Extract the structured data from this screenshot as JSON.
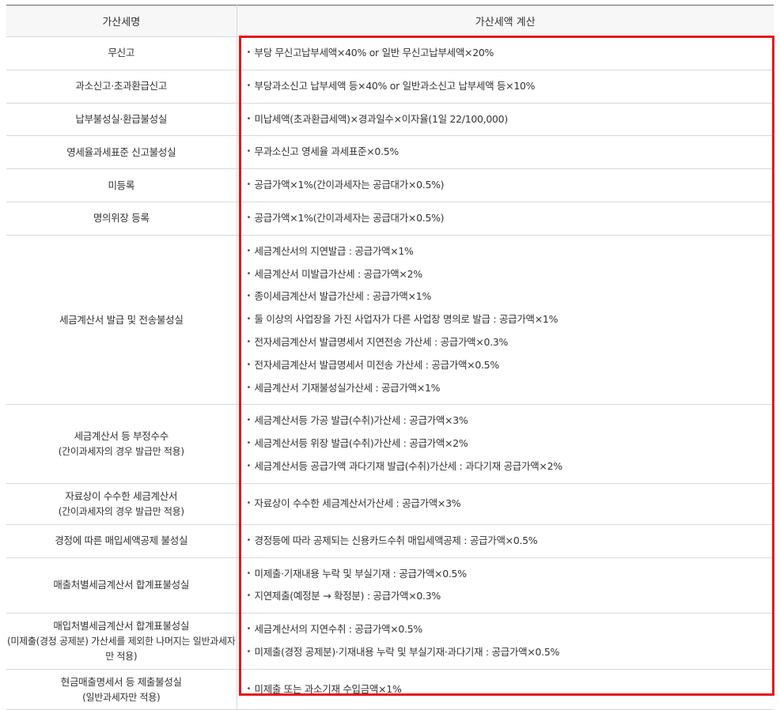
{
  "header": {
    "category": "가산세명",
    "calculation": "가산세액 계산"
  },
  "rows": [
    {
      "category": "무신고",
      "sub": "",
      "h": 41,
      "items": [
        "부당 무신고납부세액×40% or 일반 무신고납부세액×20%"
      ]
    },
    {
      "category": "과소신고·초과환급신고",
      "sub": "",
      "h": 40,
      "items": [
        "부당과소신고 납부세액 등×40% or 일반과소신고 납부세액 등×10%"
      ]
    },
    {
      "category": "납부불성실·환급불성실",
      "sub": "",
      "h": 40,
      "items": [
        "미납세액(초과환급세액)×경과일수×이자율(1일 22/100,000)"
      ]
    },
    {
      "category": "영세율과세표준 신고불성실",
      "sub": "",
      "h": 41,
      "items": [
        "무과소신고 영세율 과세표준×0.5%"
      ]
    },
    {
      "category": "미등록",
      "sub": "",
      "h": 40,
      "items": [
        "공급가액×1%(간이과세자는 공급대가×0.5%)"
      ]
    },
    {
      "category": "명의위장 등록",
      "sub": "",
      "h": 41,
      "items": [
        "공급가액×1%(간이과세자는 공급대가×0.5%)"
      ]
    },
    {
      "category": "세금계산서 발급 및 전송불성실",
      "sub": "",
      "h": 213,
      "items": [
        "세금계산서의 지연발급 : 공급가액×1%",
        "세금계산서 미발급가산세 : 공급가액×2%",
        "종이세금계산서 발급가산세 : 공급가액×1%",
        "둘 이상의 사업장을 가진 사업자가 다른 사업장 명의로 발급 : 공급가액×1%",
        "전자세금계산서 발급명세서 지연전송 가산세 : 공급가액×0.3%",
        "전자세금계산서 발급명세서 미전송 가산세 : 공급가액×0.5%",
        "세금계산서 기재불성실가산세 : 공급가액×1%"
      ]
    },
    {
      "category": "세금계산서 등 부정수수",
      "sub": "(간이과세자의 경우 발급만 적용)",
      "h": 98,
      "items": [
        "세금계산서등 가공 발급(수취)가산세 : 공급가액×3%",
        "세금계산서등 위장 발급(수취)가산세 : 공급가액×2%",
        "세금계산서등 공급가액 과다기재 발급(수취)가산세 : 과다기재 공급가액×2%"
      ]
    },
    {
      "category": "자료상이 수수한 세금계산서",
      "sub": "(간이과세자의 경우 발급만 적용)",
      "h": 52,
      "items": [
        "자료상이 수수한 세금계산서가산세 : 공급가액×3%"
      ]
    },
    {
      "category": "경정에 따른 매입세액공제 불성실",
      "sub": "",
      "h": 40,
      "items": [
        "경정등에 따라 공제되는 신용카드수취 매입세액공제 : 공급가액×0.5%"
      ]
    },
    {
      "category": "매출처별세금계산서 합계표불성실",
      "sub": "",
      "h": 70,
      "items": [
        "미제출·기재내용 누락 및 부실기재 : 공급가액×0.5%",
        "지연제출(예정분 → 확정분) : 공급가액×0.3%"
      ]
    },
    {
      "category": "매입처별세금계산서 합계표불성실",
      "sub": "(미제출(경정 공제분) 가산세를 제외한 나머지는 일반과세자만 적용)",
      "h": 71,
      "items": [
        "세금계산서의 지연수취 : 공급가액×0.5%",
        "미제출(경정 공제분)·기재내용 누락 및 부실기재·과다기재 : 공급가액×0.5%"
      ]
    },
    {
      "category": "현금매출명세서 등 제출불성실",
      "sub": "(일반과세자만 적용)",
      "h": 51,
      "items": [
        "미제출 또는 과소기재 수입금액×1%"
      ]
    }
  ],
  "colors": {
    "highlight": "#e8141b",
    "header_bg": "#f7f7f7",
    "border": "#d8d8d8"
  }
}
